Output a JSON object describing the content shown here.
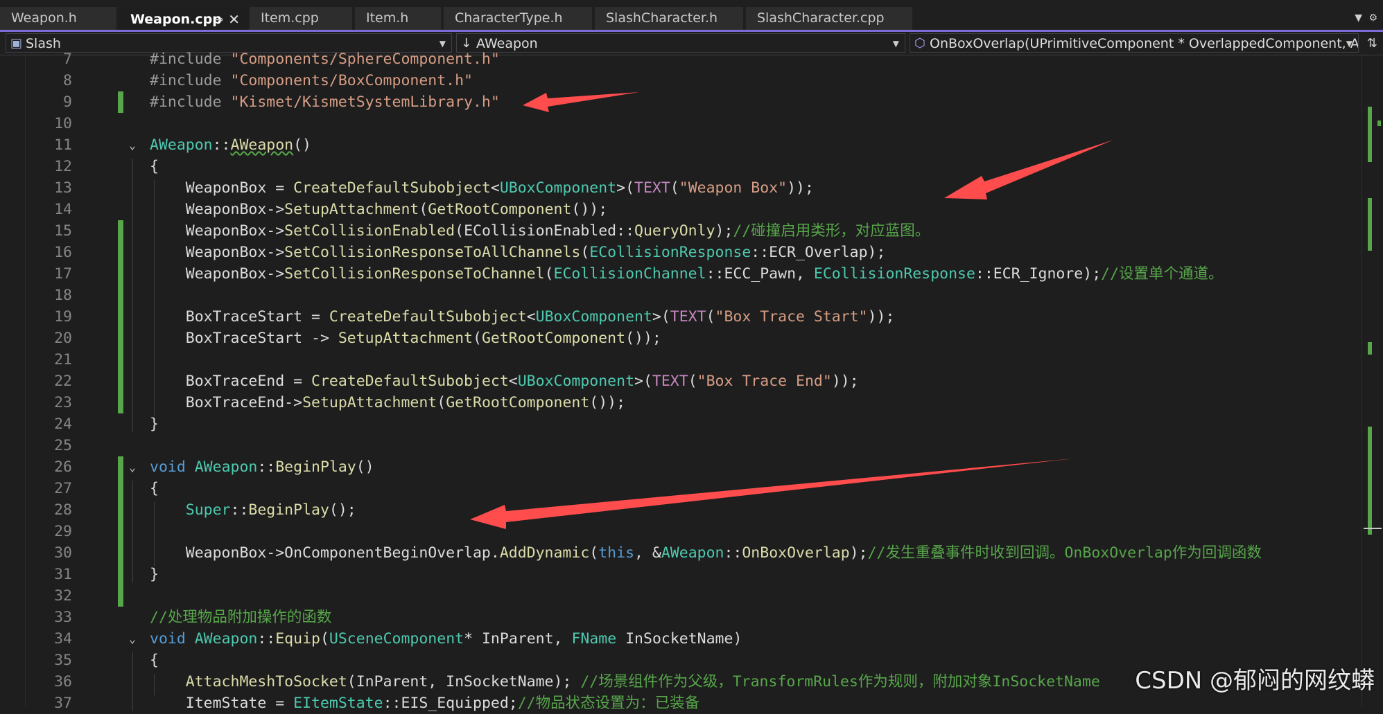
{
  "tabs": [
    {
      "label": "Weapon.h",
      "active": false
    },
    {
      "label": "Weapon.cpp",
      "active": true
    },
    {
      "label": "Item.cpp",
      "active": false
    },
    {
      "label": "Item.h",
      "active": false
    },
    {
      "label": "CharacterType.h",
      "active": false
    },
    {
      "label": "SlashCharacter.h",
      "active": false
    },
    {
      "label": "SlashCharacter.cpp",
      "active": false
    }
  ],
  "tab_icons": {
    "pin": "pin-icon",
    "close": "close-icon",
    "overflow": "chevron-down-icon",
    "settings": "gear-icon"
  },
  "navbar": {
    "project": "Slash",
    "scope": "AWeapon",
    "member": "OnBoxOverlap(UPrimitiveComponent * OverlappedComponent, AAct"
  },
  "lines": [
    {
      "n": "7",
      "tokens": [
        [
          "pp",
          "#include "
        ],
        [
          "str",
          "\"Components/SphereComponent.h\""
        ]
      ]
    },
    {
      "n": "8",
      "tokens": [
        [
          "pp",
          "#include "
        ],
        [
          "str",
          "\"Components/BoxComponent.h\""
        ]
      ]
    },
    {
      "n": "9",
      "tokens": [
        [
          "pp",
          "#include "
        ],
        [
          "str",
          "\"Kismet/KismetSystemLibrary.h\""
        ]
      ]
    },
    {
      "n": "10",
      "tokens": []
    },
    {
      "n": "11",
      "tokens": [
        [
          "type",
          "AWeapon"
        ],
        [
          "plain",
          "::"
        ],
        [
          "fnsq",
          "AWeapon"
        ],
        [
          "plain",
          "()"
        ]
      ]
    },
    {
      "n": "12",
      "tokens": [
        [
          "plain",
          "{"
        ]
      ]
    },
    {
      "n": "13",
      "tokens": [
        [
          "plain",
          "    WeaponBox = "
        ],
        [
          "fn",
          "CreateDefaultSubobject"
        ],
        [
          "plain",
          "<"
        ],
        [
          "type",
          "UBoxComponent"
        ],
        [
          "plain",
          ">("
        ],
        [
          "mac",
          "TEXT"
        ],
        [
          "plain",
          "("
        ],
        [
          "str",
          "\"Weapon Box\""
        ],
        [
          "plain",
          "));"
        ]
      ]
    },
    {
      "n": "14",
      "tokens": [
        [
          "plain",
          "    WeaponBox->"
        ],
        [
          "fn",
          "SetupAttachment"
        ],
        [
          "plain",
          "("
        ],
        [
          "fn",
          "GetRootComponent"
        ],
        [
          "plain",
          "());"
        ]
      ]
    },
    {
      "n": "15",
      "tokens": [
        [
          "plain",
          "    WeaponBox->"
        ],
        [
          "fn",
          "SetCollisionEnabled"
        ],
        [
          "plain",
          "(ECollisionEnabled::"
        ],
        [
          "fn",
          "QueryOnly"
        ],
        [
          "plain",
          ");"
        ],
        [
          "cmt",
          "//碰撞启用类形，对应蓝图。"
        ]
      ]
    },
    {
      "n": "16",
      "tokens": [
        [
          "plain",
          "    WeaponBox->"
        ],
        [
          "fn",
          "SetCollisionResponseToAllChannels"
        ],
        [
          "plain",
          "("
        ],
        [
          "type",
          "ECollisionResponse"
        ],
        [
          "plain",
          "::"
        ],
        [
          "plain",
          "ECR_Overlap);"
        ]
      ]
    },
    {
      "n": "17",
      "tokens": [
        [
          "plain",
          "    WeaponBox->"
        ],
        [
          "fn",
          "SetCollisionResponseToChannel"
        ],
        [
          "plain",
          "("
        ],
        [
          "type",
          "ECollisionChannel"
        ],
        [
          "plain",
          "::ECC_Pawn, "
        ],
        [
          "type",
          "ECollisionResponse"
        ],
        [
          "plain",
          "::ECR_Ignore);"
        ],
        [
          "cmt",
          "//设置单个通道。"
        ]
      ]
    },
    {
      "n": "18",
      "tokens": []
    },
    {
      "n": "19",
      "tokens": [
        [
          "plain",
          "    BoxTraceStart = "
        ],
        [
          "fn",
          "CreateDefaultSubobject"
        ],
        [
          "plain",
          "<"
        ],
        [
          "type",
          "UBoxComponent"
        ],
        [
          "plain",
          ">("
        ],
        [
          "mac",
          "TEXT"
        ],
        [
          "plain",
          "("
        ],
        [
          "str",
          "\"Box Trace Start\""
        ],
        [
          "plain",
          "));"
        ]
      ]
    },
    {
      "n": "20",
      "tokens": [
        [
          "plain",
          "    BoxTraceStart -> "
        ],
        [
          "fn",
          "SetupAttachment"
        ],
        [
          "plain",
          "("
        ],
        [
          "fn",
          "GetRootComponent"
        ],
        [
          "plain",
          "());"
        ]
      ]
    },
    {
      "n": "21",
      "tokens": []
    },
    {
      "n": "22",
      "tokens": [
        [
          "plain",
          "    BoxTraceEnd = "
        ],
        [
          "fn",
          "CreateDefaultSubobject"
        ],
        [
          "plain",
          "<"
        ],
        [
          "type",
          "UBoxComponent"
        ],
        [
          "plain",
          ">("
        ],
        [
          "mac",
          "TEXT"
        ],
        [
          "plain",
          "("
        ],
        [
          "str",
          "\"Box Trace End\""
        ],
        [
          "plain",
          "));"
        ]
      ]
    },
    {
      "n": "23",
      "tokens": [
        [
          "plain",
          "    BoxTraceEnd->"
        ],
        [
          "fn",
          "SetupAttachment"
        ],
        [
          "plain",
          "("
        ],
        [
          "fn",
          "GetRootComponent"
        ],
        [
          "plain",
          "());"
        ]
      ]
    },
    {
      "n": "24",
      "tokens": [
        [
          "plain",
          "}"
        ]
      ]
    },
    {
      "n": "25",
      "tokens": []
    },
    {
      "n": "26",
      "tokens": [
        [
          "kw",
          "void "
        ],
        [
          "type",
          "AWeapon"
        ],
        [
          "plain",
          "::"
        ],
        [
          "fn",
          "BeginPlay"
        ],
        [
          "plain",
          "()"
        ]
      ]
    },
    {
      "n": "27",
      "tokens": [
        [
          "plain",
          "{"
        ]
      ]
    },
    {
      "n": "28",
      "tokens": [
        [
          "plain",
          "    "
        ],
        [
          "type",
          "Super"
        ],
        [
          "plain",
          "::"
        ],
        [
          "fn",
          "BeginPlay"
        ],
        [
          "plain",
          "();"
        ]
      ]
    },
    {
      "n": "29",
      "tokens": []
    },
    {
      "n": "30",
      "tokens": [
        [
          "plain",
          "    WeaponBox->OnComponentBeginOverlap."
        ],
        [
          "fn",
          "AddDynamic"
        ],
        [
          "plain",
          "("
        ],
        [
          "kw",
          "this"
        ],
        [
          "plain",
          ", &"
        ],
        [
          "type",
          "AWeapon"
        ],
        [
          "plain",
          "::"
        ],
        [
          "fn",
          "OnBoxOverlap"
        ],
        [
          "plain",
          ");"
        ],
        [
          "cmt",
          "//发生重叠事件时收到回调。OnBoxOverlap作为回调函数"
        ]
      ]
    },
    {
      "n": "31",
      "tokens": [
        [
          "plain",
          "}"
        ]
      ]
    },
    {
      "n": "32",
      "tokens": []
    },
    {
      "n": "33",
      "tokens": [
        [
          "cmt",
          "//处理物品附加操作的函数"
        ]
      ]
    },
    {
      "n": "34",
      "tokens": [
        [
          "kw",
          "void "
        ],
        [
          "type",
          "AWeapon"
        ],
        [
          "plain",
          "::"
        ],
        [
          "fn",
          "Equip"
        ],
        [
          "plain",
          "("
        ],
        [
          "type",
          "USceneComponent"
        ],
        [
          "plain",
          "* InParent, "
        ],
        [
          "type",
          "FName"
        ],
        [
          "plain",
          " InSocketName)"
        ]
      ]
    },
    {
      "n": "35",
      "tokens": [
        [
          "plain",
          "{"
        ]
      ]
    },
    {
      "n": "36",
      "tokens": [
        [
          "plain",
          "    "
        ],
        [
          "fn",
          "AttachMeshToSocket"
        ],
        [
          "plain",
          "(InParent, InSocketName); "
        ],
        [
          "cmt",
          "//场景组件作为父级，TransformRules作为规则，附加对象InSocketName"
        ]
      ]
    },
    {
      "n": "37",
      "tokens": [
        [
          "plain",
          "    ItemState = "
        ],
        [
          "type",
          "EItemState"
        ],
        [
          "plain",
          "::EIS_Equipped;"
        ],
        [
          "cmt",
          "//物品状态设置为：已装备"
        ]
      ]
    }
  ],
  "changed_lines": [
    "9",
    "15",
    "16",
    "17",
    "18",
    "19",
    "20",
    "21",
    "22",
    "23",
    "26",
    "27",
    "28",
    "29",
    "30",
    "31",
    "32"
  ],
  "fold_lines": [
    "11",
    "26",
    "34"
  ],
  "watermark": "CSDN @郁闷的网纹蟒",
  "colors": {
    "accent": "#7b6bd6",
    "change_marker": "#57a64a",
    "arrow": "#ff4d4d"
  }
}
